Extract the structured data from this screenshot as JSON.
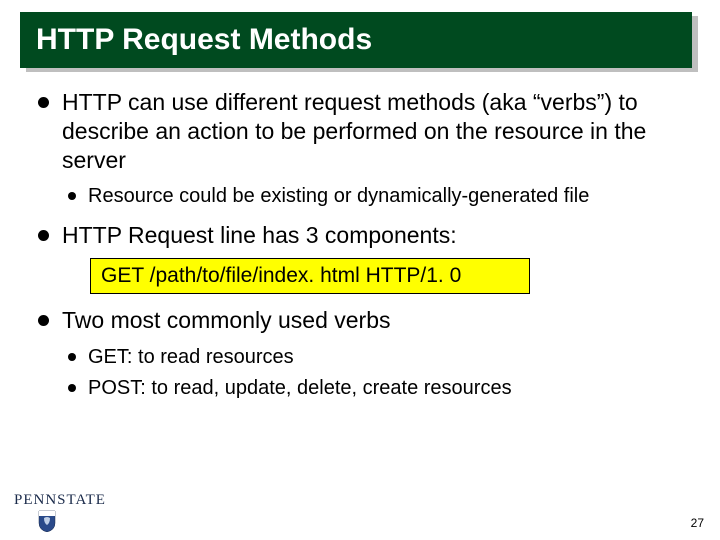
{
  "title": "HTTP Request Methods",
  "bullets": {
    "b1": "HTTP can use different request methods (aka “verbs”) to describe an action to be performed on the resource in the server",
    "b1_1": "Resource could be existing or dynamically-generated file",
    "b2": "HTTP Request line has 3 components:",
    "code": "GET /path/to/file/index. html HTTP/1. 0",
    "b3": "Two most commonly used verbs",
    "b3_1": "GET: to read resources",
    "b3_2": "POST: to read, update, delete, create resources"
  },
  "logo": "PENNSTATE",
  "page": "27"
}
